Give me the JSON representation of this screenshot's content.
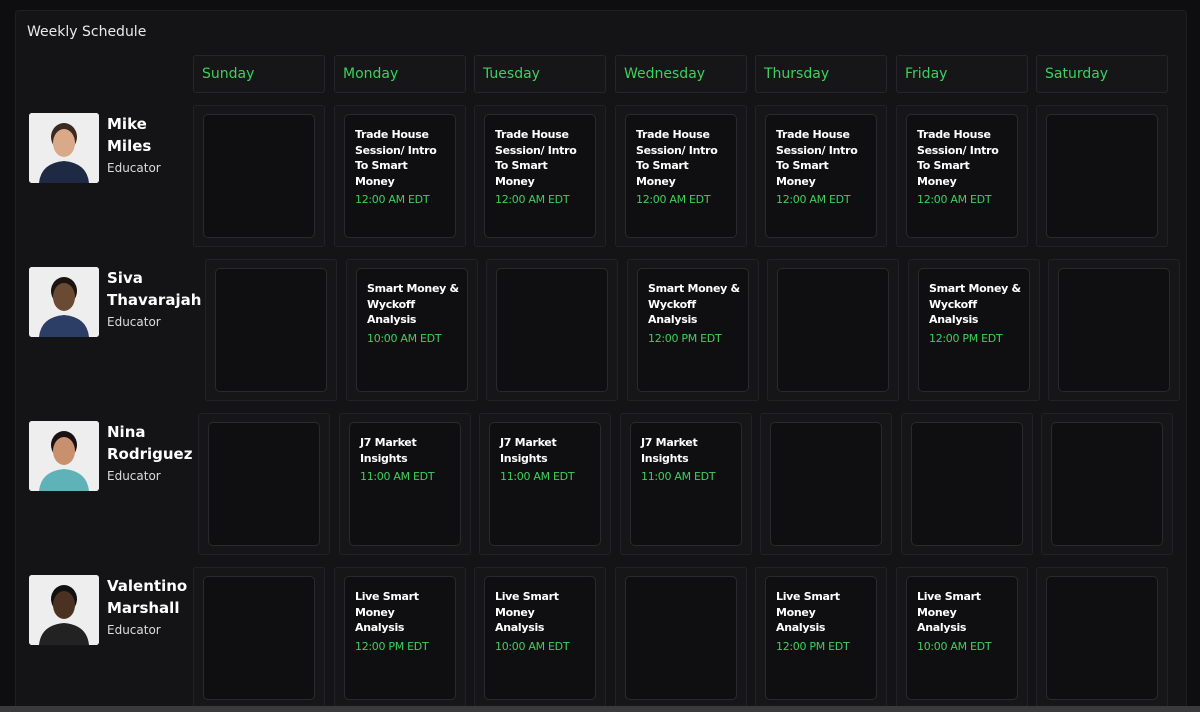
{
  "title": "Weekly Schedule",
  "days": [
    "Sunday",
    "Monday",
    "Tuesday",
    "Wednesday",
    "Thursday",
    "Friday",
    "Saturday"
  ],
  "educators": [
    {
      "name_line1": "Mike",
      "name_line2": "Miles",
      "role": "Educator",
      "sessions": [
        null,
        {
          "title": "Trade House Session/ Intro To Smart Money",
          "time": "12:00 AM EDT"
        },
        {
          "title": "Trade House Session/ Intro To Smart Money",
          "time": "12:00 AM EDT"
        },
        {
          "title": "Trade House Session/ Intro To Smart Money",
          "time": "12:00 AM EDT"
        },
        {
          "title": "Trade House Session/ Intro To Smart Money",
          "time": "12:00 AM EDT"
        },
        {
          "title": "Trade House Session/ Intro To Smart Money",
          "time": "12:00 AM EDT"
        },
        null
      ]
    },
    {
      "name_line1": "Siva",
      "name_line2": "Thavarajah",
      "role": "Educator",
      "sessions": [
        null,
        {
          "title": "Smart Money & Wyckoff Analysis",
          "time": "10:00 AM EDT"
        },
        null,
        {
          "title": "Smart Money & Wyckoff Analysis",
          "time": "12:00 PM EDT"
        },
        null,
        {
          "title": "Smart Money & Wyckoff Analysis",
          "time": "12:00 PM EDT"
        },
        null
      ]
    },
    {
      "name_line1": "Nina",
      "name_line2": "Rodriguez",
      "role": "Educator",
      "sessions": [
        null,
        {
          "title": "J7 Market Insights",
          "time": "11:00 AM EDT"
        },
        {
          "title": "J7 Market Insights",
          "time": "11:00 AM EDT"
        },
        {
          "title": "J7 Market Insights",
          "time": "11:00 AM EDT"
        },
        null,
        null,
        null
      ]
    },
    {
      "name_line1": "Valentino",
      "name_line2": "Marshall",
      "role": "Educator",
      "sessions": [
        null,
        {
          "title": "Live Smart Money Analysis",
          "time": "12:00 PM EDT"
        },
        {
          "title": "Live Smart Money Analysis",
          "time": "10:00 AM EDT"
        },
        null,
        {
          "title": "Live Smart Money Analysis",
          "time": "12:00 PM EDT"
        },
        {
          "title": "Live Smart Money Analysis",
          "time": "10:00 AM EDT"
        },
        null
      ]
    }
  ],
  "colors": {
    "accent": "#3ecf5c",
    "background": "#0e0e10",
    "panel": "#141416"
  }
}
